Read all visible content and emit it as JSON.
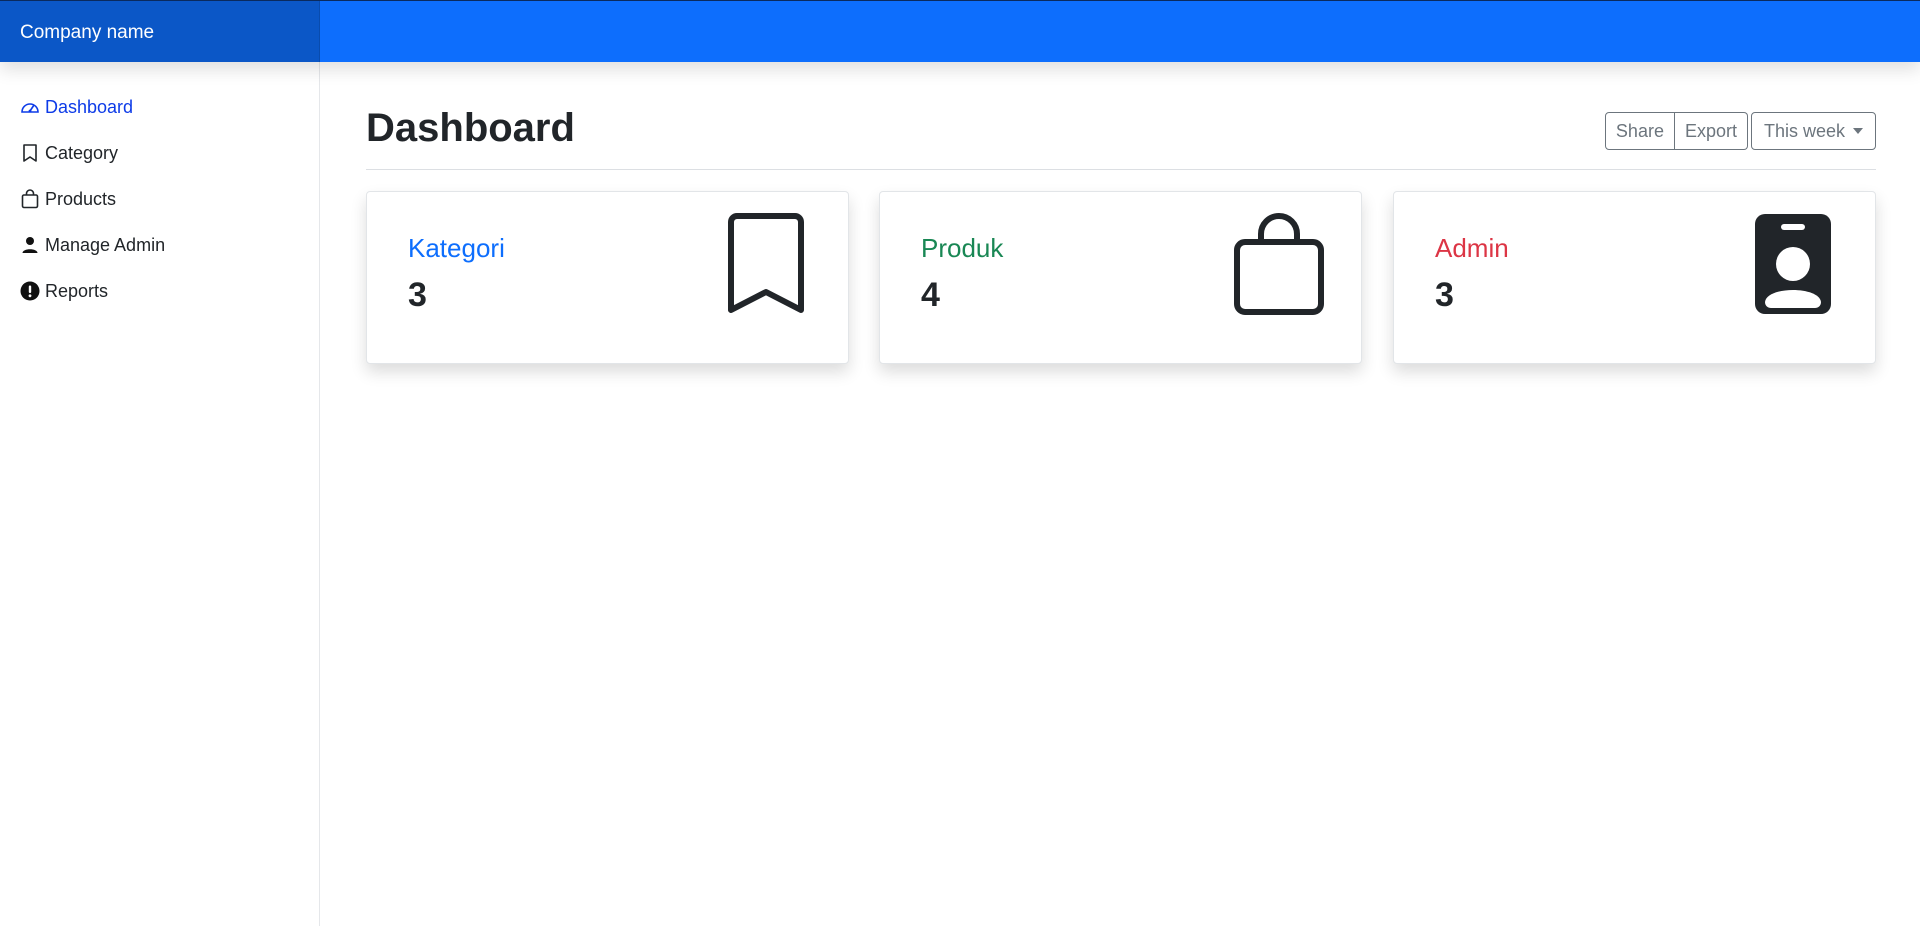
{
  "header": {
    "brand": "Company name"
  },
  "sidebar": {
    "items": [
      {
        "label": "Dashboard",
        "icon": "speedometer-icon",
        "active": true
      },
      {
        "label": "Category",
        "icon": "bookmark-icon"
      },
      {
        "label": "Products",
        "icon": "bag-icon"
      },
      {
        "label": "Manage Admin",
        "icon": "person-icon"
      },
      {
        "label": "Reports",
        "icon": "exclamation-circle-icon"
      }
    ]
  },
  "main": {
    "title": "Dashboard",
    "toolbar": {
      "share": "Share",
      "export": "Export",
      "period": "This week"
    },
    "cards": [
      {
        "label": "Kategori",
        "count": "3",
        "color": "#0d6efd",
        "icon": "bookmark-icon"
      },
      {
        "label": "Produk",
        "count": "4",
        "color": "#198754",
        "icon": "bag-icon"
      },
      {
        "label": "Admin",
        "count": "3",
        "color": "#dc3545",
        "icon": "person-badge-icon"
      }
    ]
  },
  "colors": {
    "primary": "#0d6efd",
    "brand_bg": "#0b57c7",
    "active_link": "#0d3be8"
  }
}
